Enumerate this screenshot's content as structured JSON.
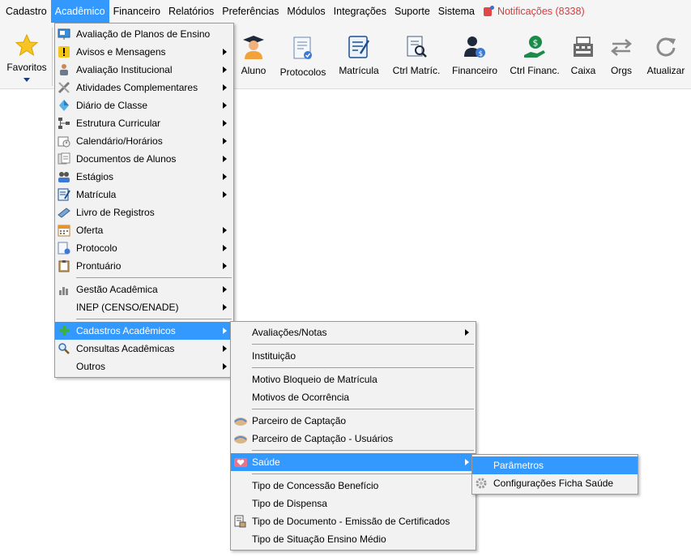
{
  "menubar": {
    "items": [
      "Cadastro",
      "Acadêmico",
      "Financeiro",
      "Relatórios",
      "Preferências",
      "Módulos",
      "Integrações",
      "Suporte",
      "Sistema"
    ],
    "notifications": "Notificações (8338)"
  },
  "toolbar": {
    "favoritos": "Favoritos",
    "aluno": "Aluno",
    "protocolos": "Protocolos",
    "matricula": "Matrícula",
    "ctrl_matric": "Ctrl Matríc.",
    "financeiro": "Financeiro",
    "ctrl_financ": "Ctrl Financ.",
    "caixa": "Caixa",
    "orgs": "Orgs",
    "atualizar": "Atualizar"
  },
  "menu_academico": {
    "items": [
      "Avaliação de Planos de Ensino",
      "Avisos e Mensagens",
      "Avaliação Institucional",
      "Atividades Complementares",
      "Diário de Classe",
      "Estrutura Curricular",
      "Calendário/Horários",
      "Documentos de Alunos",
      "Estágios",
      "Matrícula",
      "Livro de Registros",
      "Oferta",
      "Protocolo",
      "Prontuário",
      "Gestão Acadêmica",
      "INEP (CENSO/ENADE)",
      "Cadastros Acadêmicos",
      "Consultas Acadêmicas",
      "Outros"
    ]
  },
  "menu_cadastros": {
    "items": [
      "Avaliações/Notas",
      "Instituição",
      "Motivo Bloqueio de Matrícula",
      "Motivos de Ocorrência",
      "Parceiro de Captação",
      "Parceiro de Captação - Usuários",
      "Saúde",
      "Tipo de Concessão Benefício",
      "Tipo de Dispensa",
      "Tipo de Documento - Emissão de Certificados",
      "Tipo de Situação Ensino Médio"
    ]
  },
  "menu_saude": {
    "items": [
      "Parâmetros",
      "Configurações Ficha Saúde"
    ]
  },
  "colors": {
    "highlight": "#3399ff",
    "notification": "#d83b3b",
    "menu_bg": "#f2f2f2",
    "toolbar_bg": "#f5f5f5"
  }
}
